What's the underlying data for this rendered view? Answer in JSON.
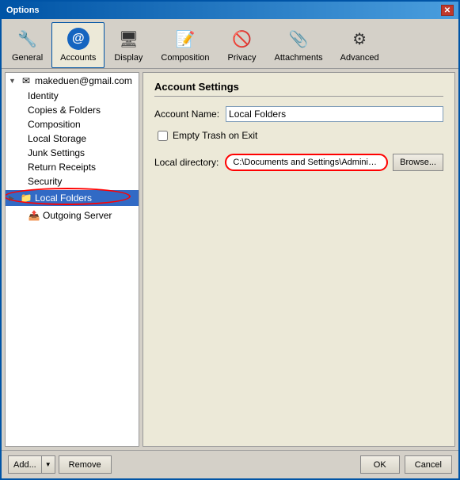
{
  "window": {
    "title": "Options"
  },
  "toolbar": {
    "items": [
      {
        "id": "general",
        "label": "General",
        "icon": "general"
      },
      {
        "id": "accounts",
        "label": "Accounts",
        "icon": "accounts",
        "active": true
      },
      {
        "id": "display",
        "label": "Display",
        "icon": "display"
      },
      {
        "id": "composition",
        "label": "Composition",
        "icon": "composition"
      },
      {
        "id": "privacy",
        "label": "Privacy",
        "icon": "privacy"
      },
      {
        "id": "attachments",
        "label": "Attachments",
        "icon": "attachments"
      },
      {
        "id": "advanced",
        "label": "Advanced",
        "icon": "advanced"
      }
    ]
  },
  "sidebar": {
    "account_name": "makeduen@gmail.com",
    "sub_items": [
      {
        "id": "identity",
        "label": "Identity"
      },
      {
        "id": "copies-folders",
        "label": "Copies & Folders"
      },
      {
        "id": "composition",
        "label": "Composition"
      },
      {
        "id": "local-storage",
        "label": "Local Storage"
      },
      {
        "id": "junk-settings",
        "label": "Junk Settings"
      },
      {
        "id": "return-receipts",
        "label": "Return Receipts"
      },
      {
        "id": "security",
        "label": "Security"
      }
    ],
    "local_folders": "Local Folders",
    "outgoing_server": "Outgoing Server"
  },
  "content": {
    "section_title": "Account Settings",
    "account_name_label": "Account Name:",
    "account_name_value": "Local Folders",
    "empty_trash_label": "Empty Trash on Exit",
    "local_directory_label": "Local directory:",
    "local_directory_value": "C:\\Documents and Settings\\Administrator\\A",
    "browse_button": "Browse..."
  },
  "bottom": {
    "add_label": "Add...",
    "remove_label": "Remove",
    "ok_label": "OK",
    "cancel_label": "Cancel"
  }
}
